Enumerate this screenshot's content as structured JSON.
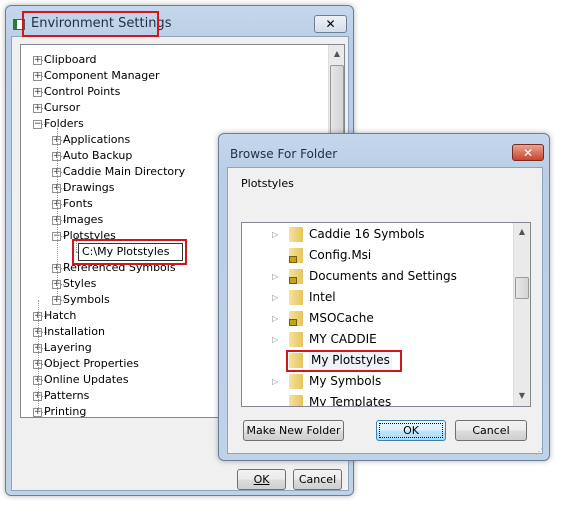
{
  "env": {
    "title": "Environment Settings",
    "close": "✕",
    "tree": [
      {
        "label": "Clipboard",
        "level": 0,
        "state": "plus"
      },
      {
        "label": "Component Manager",
        "level": 0,
        "state": "plus"
      },
      {
        "label": "Control Points",
        "level": 0,
        "state": "plus"
      },
      {
        "label": "Cursor",
        "level": 0,
        "state": "plus"
      },
      {
        "label": "Folders",
        "level": 0,
        "state": "minus"
      },
      {
        "label": "Applications",
        "level": 1,
        "state": "plus"
      },
      {
        "label": "Auto Backup",
        "level": 1,
        "state": "plus"
      },
      {
        "label": "Caddie Main Directory",
        "level": 1,
        "state": "plus"
      },
      {
        "label": "Drawings",
        "level": 1,
        "state": "plus"
      },
      {
        "label": "Fonts",
        "level": 1,
        "state": "plus"
      },
      {
        "label": "Images",
        "level": 1,
        "state": "plus"
      },
      {
        "label": "Plotstyles",
        "level": 1,
        "state": "minus"
      },
      {
        "label": "C:\\My Plotstyles",
        "level": 2,
        "state": "edit"
      },
      {
        "label": "Referenced Symbols",
        "level": 1,
        "state": "plus"
      },
      {
        "label": "Styles",
        "level": 1,
        "state": "plus"
      },
      {
        "label": "Symbols",
        "level": 1,
        "state": "plus"
      },
      {
        "label": "Hatch",
        "level": 0,
        "state": "plus"
      },
      {
        "label": "Installation",
        "level": 0,
        "state": "plus"
      },
      {
        "label": "Layering",
        "level": 0,
        "state": "plus"
      },
      {
        "label": "Object Properties",
        "level": 0,
        "state": "plus"
      },
      {
        "label": "Online Updates",
        "level": 0,
        "state": "plus"
      },
      {
        "label": "Patterns",
        "level": 0,
        "state": "plus"
      },
      {
        "label": "Printing",
        "level": 0,
        "state": "plus"
      }
    ],
    "ok": "OK",
    "cancel": "Cancel"
  },
  "browse": {
    "title": "Browse For Folder",
    "close": "✕",
    "label": "Plotstyles",
    "folders": [
      {
        "name": "Caddie 16 Symbols",
        "expandable": true,
        "locked": false
      },
      {
        "name": "Config.Msi",
        "expandable": false,
        "locked": true
      },
      {
        "name": "Documents and Settings",
        "expandable": true,
        "locked": true
      },
      {
        "name": "Intel",
        "expandable": true,
        "locked": false
      },
      {
        "name": "MSOCache",
        "expandable": true,
        "locked": true
      },
      {
        "name": "MY CADDIE",
        "expandable": true,
        "locked": false
      },
      {
        "name": "My Plotstyles",
        "expandable": false,
        "locked": false,
        "selected": true
      },
      {
        "name": "My Symbols",
        "expandable": true,
        "locked": false
      },
      {
        "name": "My Templates",
        "expandable": false,
        "locked": false
      }
    ],
    "make_new_folder": "Make New Folder",
    "ok": "OK",
    "cancel": "Cancel"
  },
  "colors": {
    "highlight": "#d2161d"
  }
}
